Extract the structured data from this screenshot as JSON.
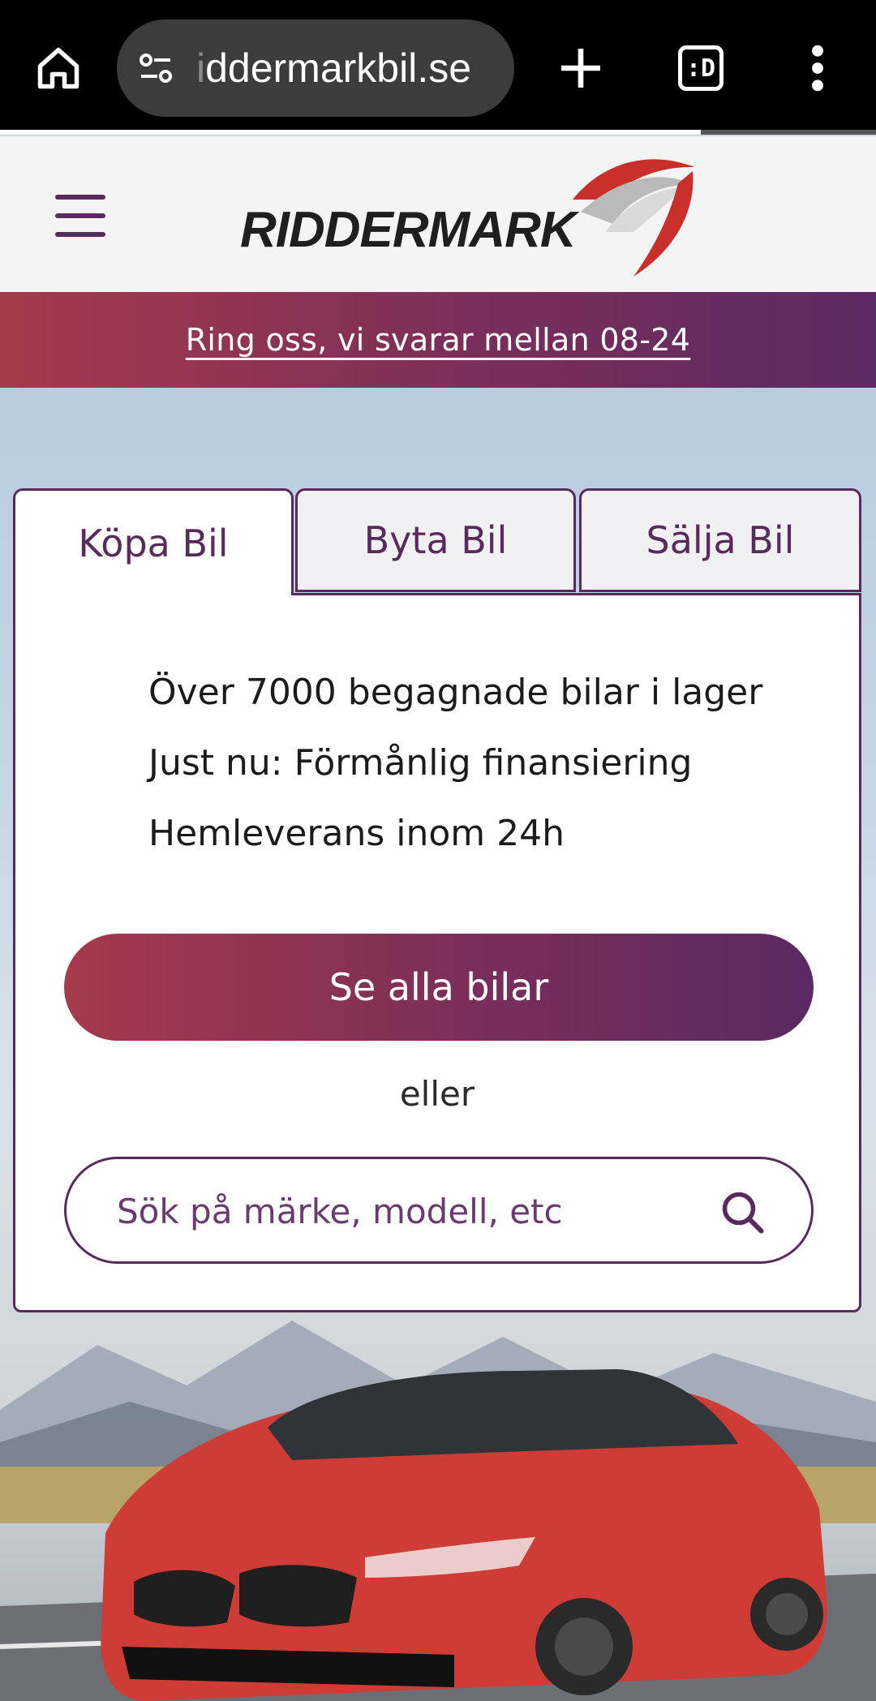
{
  "browser": {
    "url_faded": "i",
    "url_text": "ddermarkbil.se",
    "tab_count": ":D"
  },
  "header": {
    "logo_text": "RIDDERMARK"
  },
  "promo": {
    "text": "Ring oss, vi svarar mellan 08-24"
  },
  "tabs": [
    {
      "label": "Köpa Bil",
      "active": true
    },
    {
      "label": "Byta Bil",
      "active": false
    },
    {
      "label": "Sälja Bil",
      "active": false
    }
  ],
  "card": {
    "features": [
      "Över 7000 begagnade bilar i lager",
      "Just nu: Förmånlig finansiering",
      "Hemleverans inom 24h"
    ],
    "cta_label": "Se alla bilar",
    "or_text": "eller",
    "search_placeholder": "Sök på märke, modell, etc"
  },
  "colors": {
    "brand_purple": "#5a2a5f",
    "brand_red": "#a53a4b",
    "car_red": "#d8403a"
  },
  "icons": [
    "home-icon",
    "tune-icon",
    "plus-icon",
    "tab-switcher-icon",
    "more-vert-icon",
    "hamburger-icon",
    "search-icon"
  ]
}
